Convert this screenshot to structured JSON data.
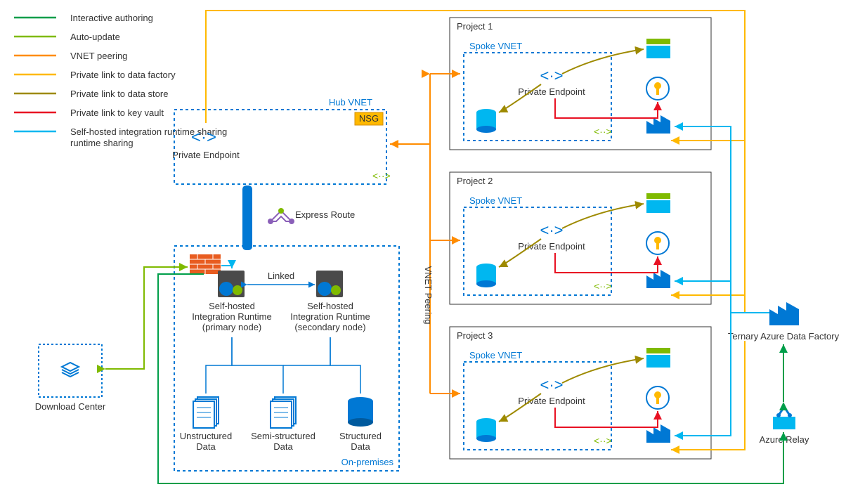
{
  "legend": {
    "items": [
      {
        "color": "#009e49",
        "label": "Interactive authoring"
      },
      {
        "color": "#7fba00",
        "label": "Auto-update"
      },
      {
        "color": "#ff8c00",
        "label": "VNET peering"
      },
      {
        "color": "#ffb900",
        "label": "Private link to data factory"
      },
      {
        "color": "#9e8a00",
        "label": "Private link to data store"
      },
      {
        "color": "#e81123",
        "label": "Private link to key vault"
      },
      {
        "color": "#00b7f0",
        "label": "Self-hosted integration runtime sharing"
      }
    ]
  },
  "hub": {
    "title": "Hub VNET",
    "pe": "Private Endpoint",
    "nsg": "NSG",
    "tag": "<..>"
  },
  "onprem": {
    "title": "On-premises",
    "linked": "Linked",
    "express": "Express Route",
    "primary": "Self-hosted\nIntegration Runtime\n(primary node)",
    "secondary": "Self-hosted\nIntegration Runtime\n(secondary node)",
    "data": {
      "unstructured": "Unstructured\nData",
      "semi": "Semi-structured\nData",
      "structured": "Structured\nData"
    }
  },
  "projects": [
    {
      "title": "Project 1",
      "spoke": "Spoke VNET",
      "pe": "Private Endpoint"
    },
    {
      "title": "Project 2",
      "spoke": "Spoke VNET",
      "pe": "Private Endpoint"
    },
    {
      "title": "Project 3",
      "spoke": "Spoke VNET",
      "pe": "Private Endpoint"
    }
  ],
  "download": "Download Center",
  "ternary": "Ternary Azure Data Factory",
  "relay": "Azure Relay",
  "peering": "VNET Peering"
}
